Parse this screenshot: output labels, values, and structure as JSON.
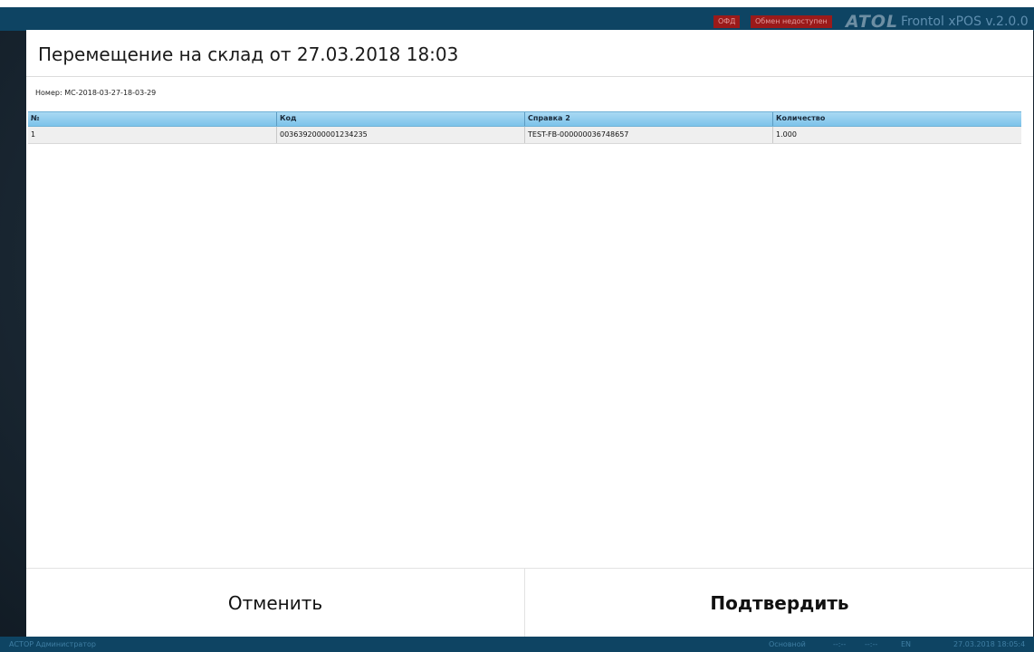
{
  "app": {
    "ofd_badge": "ОФД",
    "exchange_badge": "Обмен недоступен",
    "logo_text": "ATOL",
    "version_text": "Frontol xPOS v.2.0.0"
  },
  "dialog": {
    "title": "Перемещение на склад от 27.03.2018 18:03",
    "doc_number_label": "Номер:",
    "doc_number_value": "МС-2018-03-27-18-03-29",
    "table": {
      "columns": [
        "№",
        "Код",
        "Справка 2",
        "Количество"
      ],
      "rows": [
        [
          "1",
          "0036392000001234235",
          "TEST-FB-000000036748657",
          "1.000"
        ]
      ]
    },
    "cancel_label": "Отменить",
    "confirm_label": "Подтвердить"
  },
  "statusbar": {
    "user": "АСТОР  Администратор",
    "mode": "Основной",
    "time1": "--:--",
    "time2": "--:--",
    "lang": "EN",
    "datetime": "27.03.2018 18:05:4"
  },
  "colors": {
    "topbar": "#0e4463",
    "grid_header": "#7cc3ea",
    "badge_red": "#9b1a1a"
  }
}
